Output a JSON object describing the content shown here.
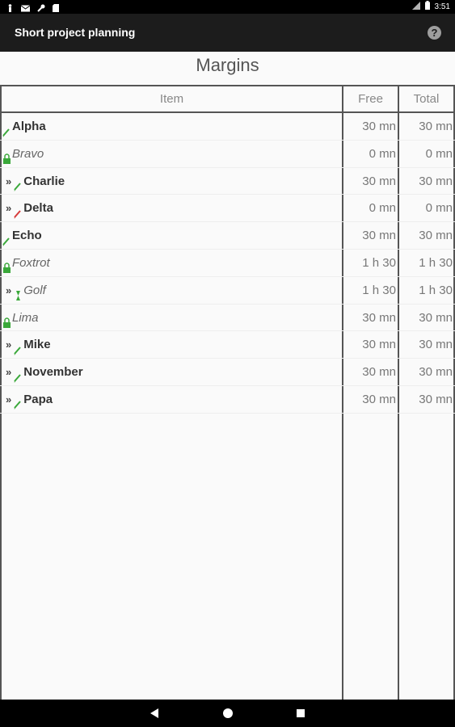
{
  "status_bar": {
    "time": "3:51",
    "icons": [
      "person-icon",
      "mail-icon",
      "wrench-icon",
      "sd-card-icon",
      "signal-icon",
      "battery-icon"
    ]
  },
  "app_bar": {
    "title": "Short project planning",
    "help_icon": "help-icon",
    "help_glyph": "?"
  },
  "page": {
    "heading": "Margins"
  },
  "table": {
    "headers": {
      "item": "Item",
      "free": "Free",
      "total": "Total"
    },
    "rows": [
      {
        "prefix": "",
        "icon": "pencil-green-icon",
        "name": "Alpha",
        "style": "bold",
        "free": "30 mn",
        "total": "30 mn"
      },
      {
        "prefix": "",
        "icon": "lock-green-icon",
        "name": "Bravo",
        "style": "italic",
        "free": "0 mn",
        "total": "0 mn"
      },
      {
        "prefix": "»",
        "icon": "pencil-green-icon",
        "name": "Charlie",
        "style": "bold",
        "free": "30 mn",
        "total": "30 mn"
      },
      {
        "prefix": "»",
        "icon": "pencil-red-icon",
        "name": "Delta",
        "style": "bold",
        "free": "0 mn",
        "total": "0 mn"
      },
      {
        "prefix": "",
        "icon": "pencil-green-icon",
        "name": "Echo",
        "style": "bold",
        "free": "30 mn",
        "total": "30 mn"
      },
      {
        "prefix": "",
        "icon": "lock-green-icon",
        "name": "Foxtrot",
        "style": "italic",
        "free": "1 h 30",
        "total": "1 h 30"
      },
      {
        "prefix": "»",
        "icon": "hourglass-green-icon",
        "name": "Golf",
        "style": "italic",
        "free": "1 h 30",
        "total": "1 h 30"
      },
      {
        "prefix": "",
        "icon": "lock-green-icon",
        "name": "Lima",
        "style": "italic",
        "free": "30 mn",
        "total": "30 mn"
      },
      {
        "prefix": "»",
        "icon": "pencil-green-icon",
        "name": "Mike",
        "style": "bold",
        "free": "30 mn",
        "total": "30 mn"
      },
      {
        "prefix": "»",
        "icon": "pencil-green-icon",
        "name": "November",
        "style": "bold",
        "free": "30 mn",
        "total": "30 mn"
      },
      {
        "prefix": "»",
        "icon": "pencil-green-icon",
        "name": "Papa",
        "style": "bold",
        "free": "30 mn",
        "total": "30 mn"
      }
    ]
  },
  "nav_bar": {
    "icons": [
      "back-icon",
      "home-icon",
      "recent-apps-icon"
    ]
  },
  "colors": {
    "green_icon": "#3aa83a",
    "red_icon": "#d63a3a",
    "app_bar": "#1c1c1c",
    "grid_line": "#555555"
  }
}
